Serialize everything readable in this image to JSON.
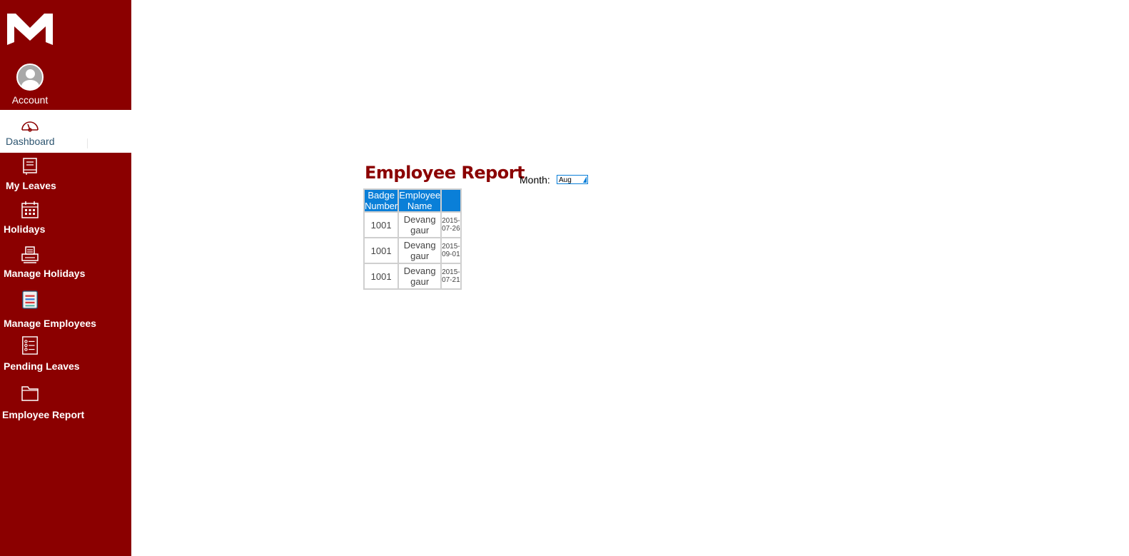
{
  "sidebar": {
    "account_label": "Account",
    "items": [
      {
        "label": "Dashboard",
        "icon": "dashboard-icon"
      },
      {
        "label": "My Leaves",
        "icon": "book-icon"
      },
      {
        "label": "Holidays",
        "icon": "calendar-icon"
      },
      {
        "label": "Manage Holidays",
        "icon": "printer-icon"
      },
      {
        "label": "Manage Employees",
        "icon": "list-book-icon"
      },
      {
        "label": "Pending Leaves",
        "icon": "checklist-icon"
      },
      {
        "label": "Employee Report",
        "icon": "folder-icon"
      }
    ]
  },
  "report": {
    "title": "Employee Report",
    "month_label": "Month:",
    "month_value": "Aug",
    "columns": [
      "Badge Number",
      "Employee Name",
      ""
    ],
    "rows": [
      [
        "1001",
        "Devang gaur",
        "2015-07-26"
      ],
      [
        "1001",
        "Devang gaur",
        "2015-09-01"
      ],
      [
        "1001",
        "Devang gaur",
        "2015-07-21"
      ]
    ]
  },
  "colors": {
    "sidebar": "#8b0000",
    "header": "#0a7fd8",
    "title": "#8b0000"
  }
}
